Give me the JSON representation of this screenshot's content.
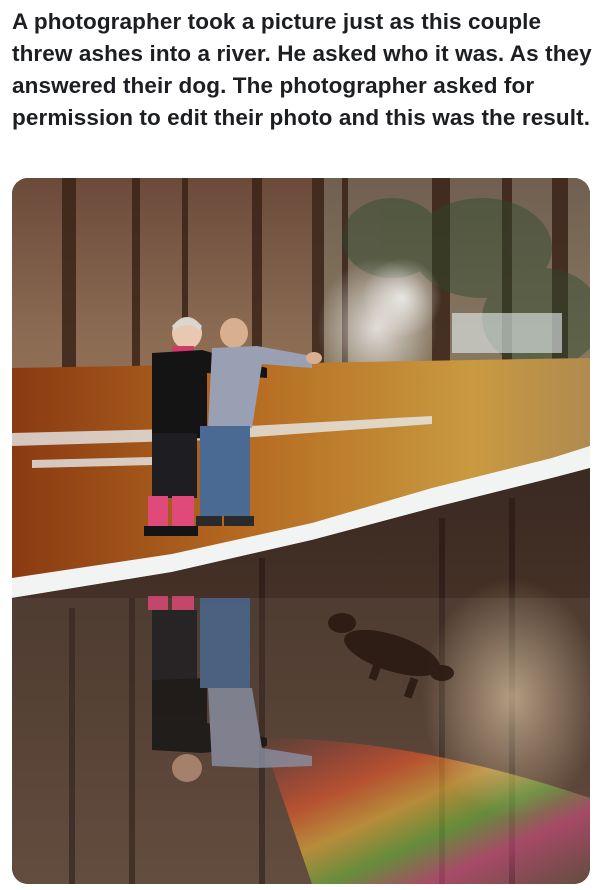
{
  "post": {
    "text": "A photographer took a picture just as this couple threw ashes into a river. He asked who it was. As they answered their dog. The photographer asked for permission to edit their photo and this was the result."
  }
}
